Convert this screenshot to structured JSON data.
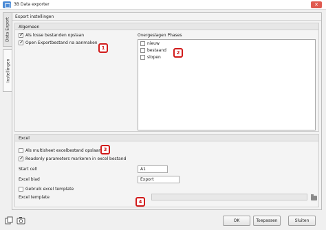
{
  "window": {
    "title": "3B Data exporter",
    "close_glyph": "✕",
    "logo_icon": "app-logo-icon"
  },
  "tabs": [
    {
      "label": "Data Export"
    },
    {
      "label": "Instellingen"
    }
  ],
  "panel": {
    "header": "Export instellingen"
  },
  "general": {
    "title": "Algemeen",
    "options": [
      {
        "label": "Als losse bestanden opslaan",
        "checked": true
      },
      {
        "label": "Open Exportbestand na aanmaken",
        "checked": true
      }
    ],
    "phases_label": "Overgeslagen Phases",
    "phases": [
      {
        "label": "nieuw",
        "checked": false
      },
      {
        "label": "bestaand",
        "checked": false
      },
      {
        "label": "slopen",
        "checked": false
      }
    ]
  },
  "excel": {
    "title": "Excel",
    "options": [
      {
        "label": "Als multisheet excelbestand opslaan",
        "checked": false
      },
      {
        "label": "Readonly parameters markeren in excel bestand",
        "checked": true
      }
    ],
    "start_cell_label": "Start cell",
    "start_cell_value": "A1",
    "sheet_label": "Excel blad",
    "sheet_value": "Export",
    "template_option": {
      "label": "Gebruik excel template",
      "checked": false
    },
    "template_label": "Excel template",
    "template_value": ""
  },
  "badges": [
    "1",
    "2",
    "3",
    "4"
  ],
  "buttons": {
    "ok": "OK",
    "apply": "Toepassen",
    "close": "Sluiten"
  },
  "icons": {
    "bottom_left": [
      "copy-icon",
      "camera-icon"
    ],
    "browse": "folder-icon"
  }
}
